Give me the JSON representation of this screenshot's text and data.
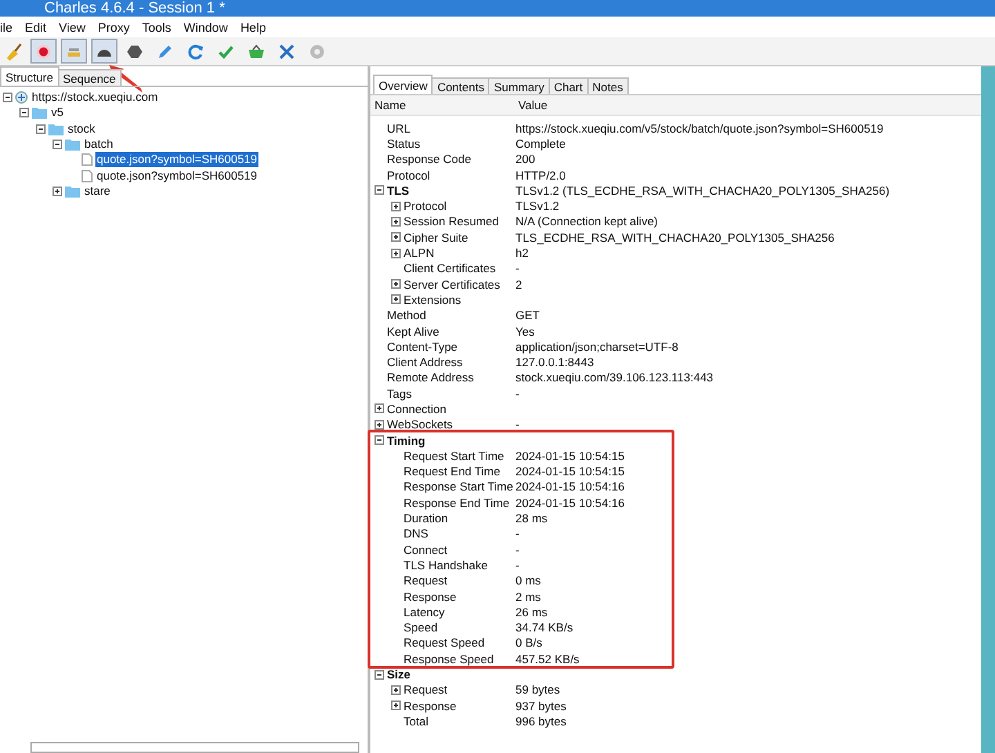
{
  "window": {
    "title": "Charles 4.6.4 - Session 1 *"
  },
  "menu": [
    "ile",
    "Edit",
    "View",
    "Proxy",
    "Tools",
    "Window",
    "Help"
  ],
  "toolbar": [
    {
      "kind": "broom",
      "pressed": false,
      "annotated": false
    },
    {
      "kind": "record",
      "pressed": true,
      "annotated": false
    },
    {
      "kind": "throttle",
      "pressed": true,
      "annotated": false
    },
    {
      "kind": "breakpoint",
      "pressed": true,
      "annotated": true
    },
    {
      "kind": "stop",
      "pressed": false,
      "annotated": false
    },
    {
      "kind": "pen",
      "pressed": false,
      "annotated": false
    },
    {
      "kind": "refresh",
      "pressed": false,
      "annotated": false
    },
    {
      "kind": "check",
      "pressed": false,
      "annotated": false
    },
    {
      "kind": "basket",
      "pressed": false,
      "annotated": false
    },
    {
      "kind": "tools",
      "pressed": false,
      "annotated": false
    },
    {
      "kind": "gear",
      "pressed": false,
      "annotated": false
    }
  ],
  "left": {
    "tabs": [
      {
        "label": "Structure",
        "selected": true
      },
      {
        "label": "Sequence",
        "selected": false
      }
    ],
    "tree": [
      {
        "label": "https://stock.xueqiu.com",
        "kind": "host",
        "expanded": true,
        "selected": false,
        "children": [
          {
            "label": "v5",
            "kind": "folder",
            "expanded": true,
            "selected": false,
            "children": [
              {
                "label": "stock",
                "kind": "folder",
                "expanded": true,
                "selected": false,
                "children": [
                  {
                    "label": "batch",
                    "kind": "folder",
                    "expanded": true,
                    "selected": false,
                    "children": [
                      {
                        "label": "quote.json?symbol=SH600519",
                        "kind": "file",
                        "selected": true
                      },
                      {
                        "label": "quote.json?symbol=SH600519",
                        "kind": "file",
                        "selected": false
                      }
                    ]
                  },
                  {
                    "label": "stare",
                    "kind": "folder",
                    "expanded": false,
                    "selected": false
                  }
                ]
              }
            ]
          }
        ]
      }
    ]
  },
  "right": {
    "tabs": [
      {
        "label": "Overview",
        "selected": true
      },
      {
        "label": "Contents",
        "selected": false
      },
      {
        "label": "Summary",
        "selected": false
      },
      {
        "label": "Chart",
        "selected": false
      },
      {
        "label": "Notes",
        "selected": false
      }
    ],
    "columns": [
      "Name",
      "Value"
    ],
    "rows": [
      {
        "name": "URL",
        "value": "https://stock.xueqiu.com/v5/stock/batch/quote.json?symbol=SH600519"
      },
      {
        "name": "Status",
        "value": "Complete"
      },
      {
        "name": "Response Code",
        "value": "200"
      },
      {
        "name": "Protocol",
        "value": "HTTP/2.0"
      },
      {
        "name": "TLS",
        "value": "TLSv1.2 (TLS_ECDHE_RSA_WITH_CHACHA20_POLY1305_SHA256)",
        "kind": "section",
        "expanded": true,
        "children": [
          {
            "name": "Protocol",
            "value": "TLSv1.2",
            "expanded": false
          },
          {
            "name": "Session Resumed",
            "value": "N/A (Connection kept alive)",
            "expanded": false
          },
          {
            "name": "Cipher Suite",
            "value": "TLS_ECDHE_RSA_WITH_CHACHA20_POLY1305_SHA256",
            "expanded": false
          },
          {
            "name": "ALPN",
            "value": "h2",
            "expanded": false
          },
          {
            "name": "Client Certificates",
            "value": "-"
          },
          {
            "name": "Server Certificates",
            "value": "2",
            "expanded": false
          },
          {
            "name": "Extensions",
            "expanded": false
          }
        ]
      },
      {
        "name": "Method",
        "value": "GET"
      },
      {
        "name": "Kept Alive",
        "value": "Yes"
      },
      {
        "name": "Content-Type",
        "value": "application/json;charset=UTF-8"
      },
      {
        "name": "Client Address",
        "value": "127.0.0.1:8443"
      },
      {
        "name": "Remote Address",
        "value": "stock.xueqiu.com/39.106.123.113:443"
      },
      {
        "name": "Tags",
        "value": "-"
      },
      {
        "name": "Connection",
        "expanded": false
      },
      {
        "name": "WebSockets",
        "value": "-",
        "expanded": false
      },
      {
        "name": "Timing",
        "kind": "section",
        "expanded": true,
        "annotated": true,
        "children": [
          {
            "name": "Request Start Time",
            "value": "2024-01-15 10:54:15"
          },
          {
            "name": "Request End Time",
            "value": "2024-01-15 10:54:15"
          },
          {
            "name": "Response Start Time",
            "value": "2024-01-15 10:54:16"
          },
          {
            "name": "Response End Time",
            "value": "2024-01-15 10:54:16"
          },
          {
            "name": "Duration",
            "value": "28 ms"
          },
          {
            "name": "DNS",
            "value": "-"
          },
          {
            "name": "Connect",
            "value": "-"
          },
          {
            "name": "TLS Handshake",
            "value": "-"
          },
          {
            "name": "Request",
            "value": "0 ms"
          },
          {
            "name": "Response",
            "value": "2 ms"
          },
          {
            "name": "Latency",
            "value": "26 ms"
          },
          {
            "name": "Speed",
            "value": "34.74 KB/s"
          },
          {
            "name": "Request Speed",
            "value": "0 B/s"
          },
          {
            "name": "Response Speed",
            "value": "457.52 KB/s"
          }
        ]
      },
      {
        "name": "Size",
        "kind": "section",
        "expanded": true,
        "children": [
          {
            "name": "Request",
            "value": "59 bytes",
            "expanded": false
          },
          {
            "name": "Response",
            "value": "937 bytes",
            "expanded": false
          },
          {
            "name": "Total",
            "value": "996 bytes"
          }
        ]
      }
    ]
  }
}
